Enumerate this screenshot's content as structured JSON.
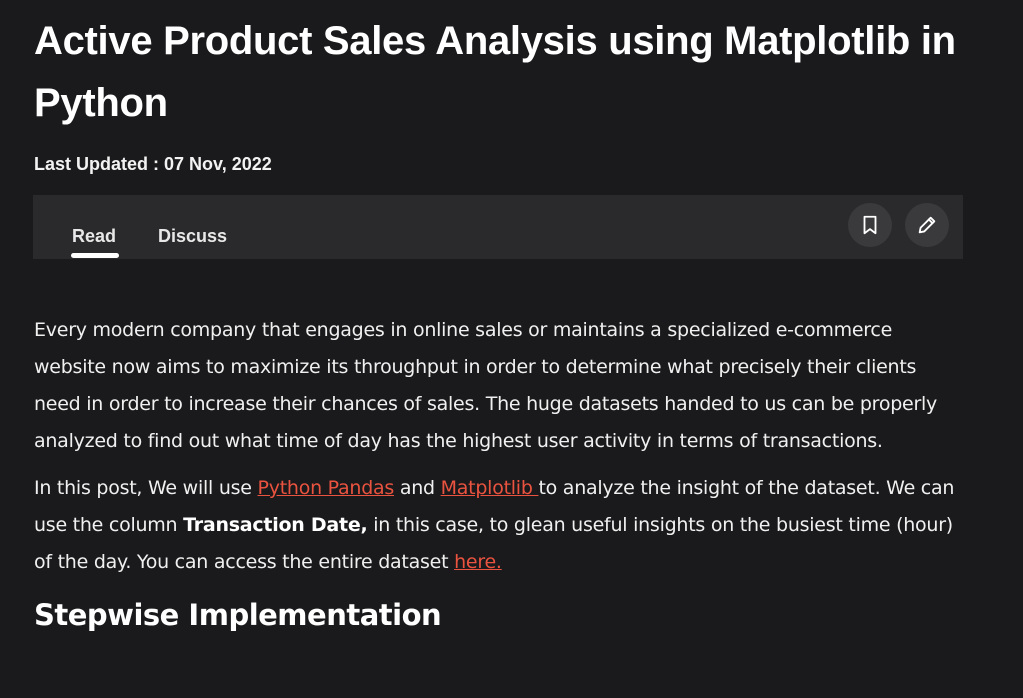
{
  "article": {
    "title": "Active Product Sales Analysis using Matplotlib in Python",
    "updated_label": "Last Updated : 07 Nov, 2022"
  },
  "tabs": {
    "read": "Read",
    "discuss": "Discuss",
    "active": "Read"
  },
  "actions": {
    "bookmark_icon": "bookmark-icon",
    "edit_icon": "pencil-icon"
  },
  "body": {
    "p1": "Every modern company that engages in online sales or maintains a specialized e-commerce website now aims to maximize its throughput in order to determine what precisely their clients need in order to increase their chances of sales. The huge datasets handed to us can be properly analyzed to find out what time of day has the highest user activity in terms of transactions.",
    "p2_a": "In this post, We will use ",
    "p2_link1": "Python Pandas",
    "p2_b": " and ",
    "p2_link2": "Matplotlib ",
    "p2_c": "to analyze the insight of the dataset. We can use the column ",
    "p2_bold": "Transaction Date,",
    "p2_d": " in this case, to glean useful insights on the busiest time (hour) of the day. You can access the entire dataset ",
    "p2_link3": "here.",
    "subheading": "Stepwise Implementation"
  },
  "colors": {
    "background": "#1a1a1c",
    "tabbar": "#2a2a2c",
    "link": "#e9533f",
    "text": "#f0f0f0"
  }
}
